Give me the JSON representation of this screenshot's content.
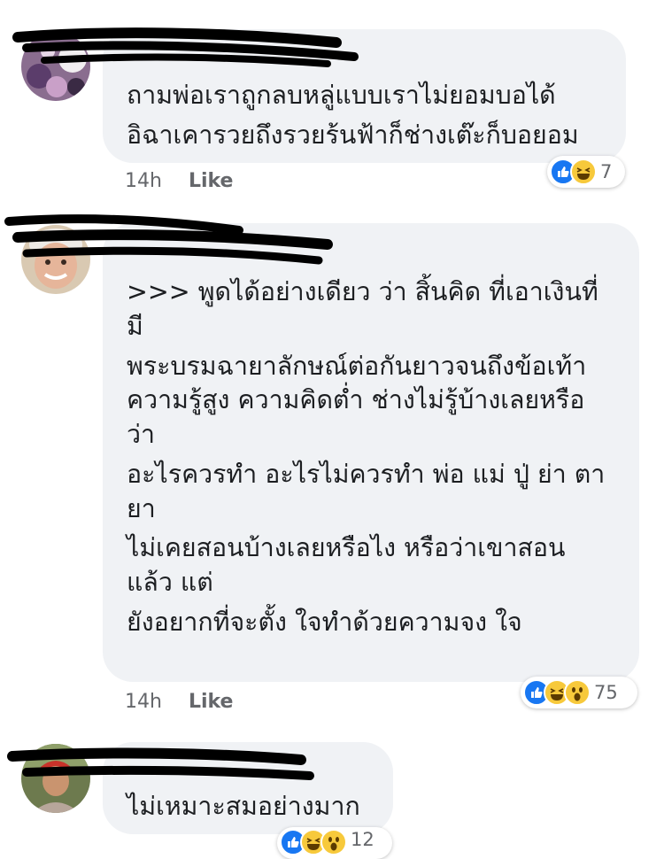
{
  "comments": [
    {
      "lines": [
        "ถามพ่อเราถูกลบหลู่แบบเราไม่ยอมบอได้",
        "อิฉาเคารวยถึงรวยร้นฟ้าก็ช่างเต๊ะก็บอยอม"
      ],
      "time": "14h",
      "like_label": "Like",
      "reaction_count": "7",
      "reactions": [
        "like-icon",
        "haha-icon"
      ]
    },
    {
      "lines": [
        ">>> พูดได้อย่างเดียว ว่า สิ้นคิด ที่เอาเงินที่",
        "มี",
        "พระบรมฉายาลักษณ์ต่อกันยาวจนถึงข้อเท้า",
        "ความรู้สูง ความคิดต่ำ ช่างไม่รู้บ้างเลยหรือ",
        "ว่า",
        "อะไรควรทำ อะไรไม่ควรทำ พ่อ แม่ ปู่ ย่า ตา",
        "ยา",
        "ไม่เคยสอนบ้างเลยหรือไง หรือว่าเขาสอน",
        "แล้ว แต่",
        "ยังอยากที่จะตั้ง ใจทำด้วยความจง ใจ"
      ],
      "time": "14h",
      "like_label": "Like",
      "reaction_count": "75",
      "reactions": [
        "like-icon",
        "haha-icon",
        "wow-icon"
      ]
    },
    {
      "lines": [
        "ไม่เหมาะสมอย่างมาก"
      ],
      "time": "",
      "like_label": "",
      "reaction_count": "12",
      "reactions": [
        "like-icon",
        "haha-icon",
        "wow-icon"
      ]
    }
  ]
}
